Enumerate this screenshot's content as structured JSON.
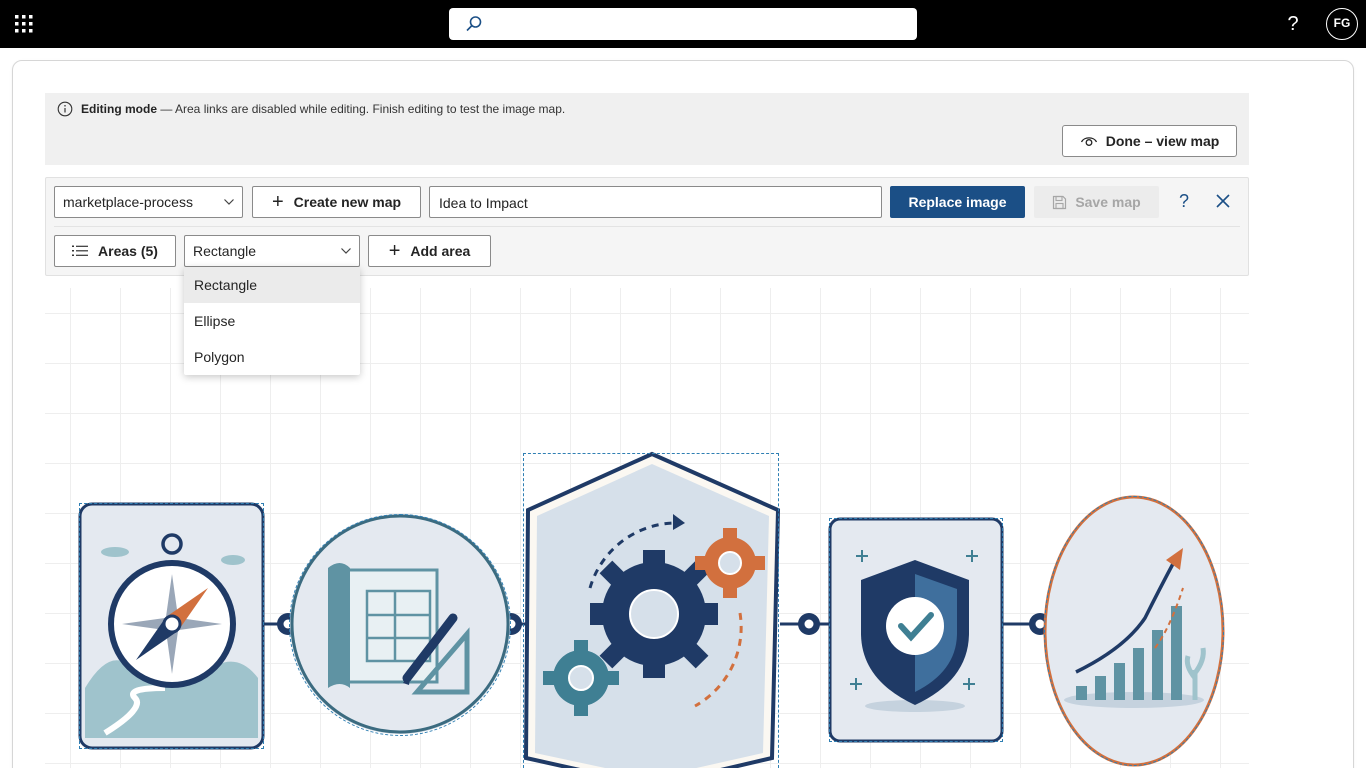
{
  "topbar": {
    "search_placeholder": "",
    "help_label": "?",
    "avatar_initials": "FG"
  },
  "banner": {
    "title": "Editing mode",
    "message": " — Area links are disabled while editing. Finish editing to test the image map.",
    "done_label": "Done – view map"
  },
  "toolbar": {
    "map_select_value": "marketplace-process",
    "create_label": "Create new map",
    "title_value": "Idea to Impact",
    "replace_label": "Replace image",
    "save_label": "Save map",
    "help_label": "?"
  },
  "areas": {
    "list_label": "Areas (5)",
    "shape_select_value": "Rectangle",
    "add_label": "Add area",
    "shape_options": [
      "Rectangle",
      "Ellipse",
      "Polygon"
    ]
  },
  "colors": {
    "topbar": "#000000",
    "primary": "#1b4f86",
    "navy": "#1f3a66",
    "teal": "#3f7f93",
    "orange": "#d2703e",
    "area_outline": "#2f7fb3"
  }
}
